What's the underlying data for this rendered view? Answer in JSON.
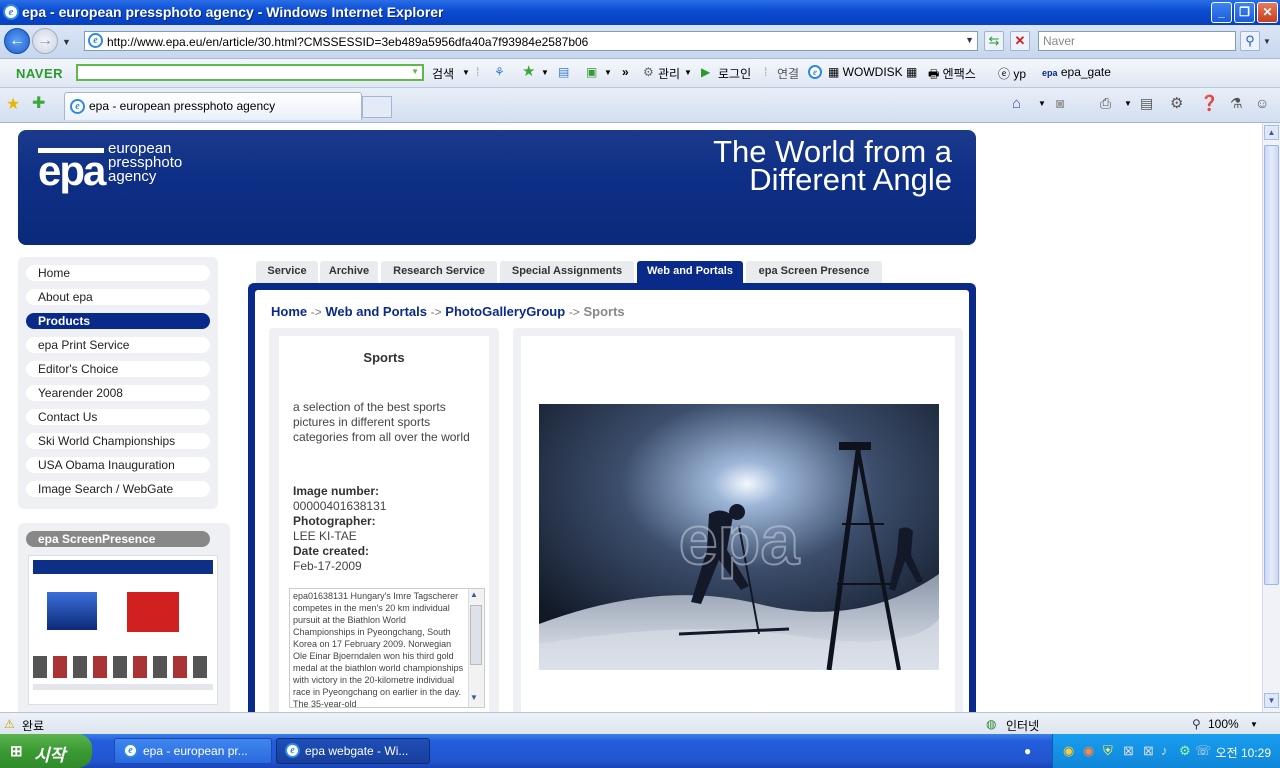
{
  "window": {
    "title": "epa - european pressphoto agency - Windows Internet Explorer",
    "min_symbol": "_",
    "max_symbol": "❐",
    "close_symbol": "✕"
  },
  "address_bar": {
    "url": "http://www.epa.eu/en/article/30.html?CMSSESSID=3eb489a5956dfa40a7f93984e2587b06",
    "search_placeholder": "Naver"
  },
  "naver_toolbar": {
    "logo": "NAVER",
    "search_label": "검색",
    "manage_label": "관리",
    "login_label": "로그인",
    "links_label": "연결",
    "wowdisk": "WOWDISK",
    "enpax": "엔팩스",
    "yp": "yp",
    "epa_gate": "epa_gate"
  },
  "tabs": {
    "active_tab_label": "epa - european pressphoto agency"
  },
  "banner": {
    "logo_text": "epa",
    "logo_sub": [
      "european",
      "pressphoto",
      "agency"
    ],
    "slogan_line1": "The World from a",
    "slogan_line2": "Different Angle"
  },
  "left_nav": {
    "items": [
      "Home",
      "About epa",
      "Products",
      "epa Print Service",
      "Editor's Choice",
      "Yearender 2008",
      "Contact Us",
      "Ski World Championships",
      "USA Obama Inauguration",
      "Image Search / WebGate"
    ],
    "active_index": 2
  },
  "screen_presence": {
    "header": "epa ScreenPresence"
  },
  "content_tabs": {
    "items": [
      "Service",
      "Archive",
      "Research Service",
      "Special Assignments",
      "Web and Portals",
      "epa Screen Presence"
    ],
    "active_index": 4
  },
  "breadcrumb": {
    "home": "Home",
    "sep": "->",
    "level1": "Web and Portals",
    "level2": "PhotoGalleryGroup",
    "current": "Sports"
  },
  "gallery": {
    "title": "Sports",
    "description": "a selection of the best sports pictures in different sports categories from all over the world",
    "image_number_label": "Image number:",
    "image_number": "00000401638131",
    "photographer_label": "Photographer:",
    "photographer": "LEE KI-TAE",
    "date_label": "Date created:",
    "date": "Feb-17-2009",
    "caption": "epa01638131 Hungary's Imre Tagscherer competes in the men's 20 km individual pursuit at the Biathlon World Championships in Pyeongchang, South Korea on 17 February 2009. Norwegian Ole Einar Bjoerndalen won his third gold medal at the biathlon world championships with victory in the 20-kilometre individual race in Pyeongchang on earlier in the day. The 35-year-old",
    "watermark": "epa"
  },
  "status_bar": {
    "status": "완료",
    "zone": "인터넷",
    "zoom": "100%"
  },
  "taskbar": {
    "start": "시작",
    "task1": "epa - european pr...",
    "task2": "epa webgate - Wi...",
    "clock": "오전 10:29"
  }
}
